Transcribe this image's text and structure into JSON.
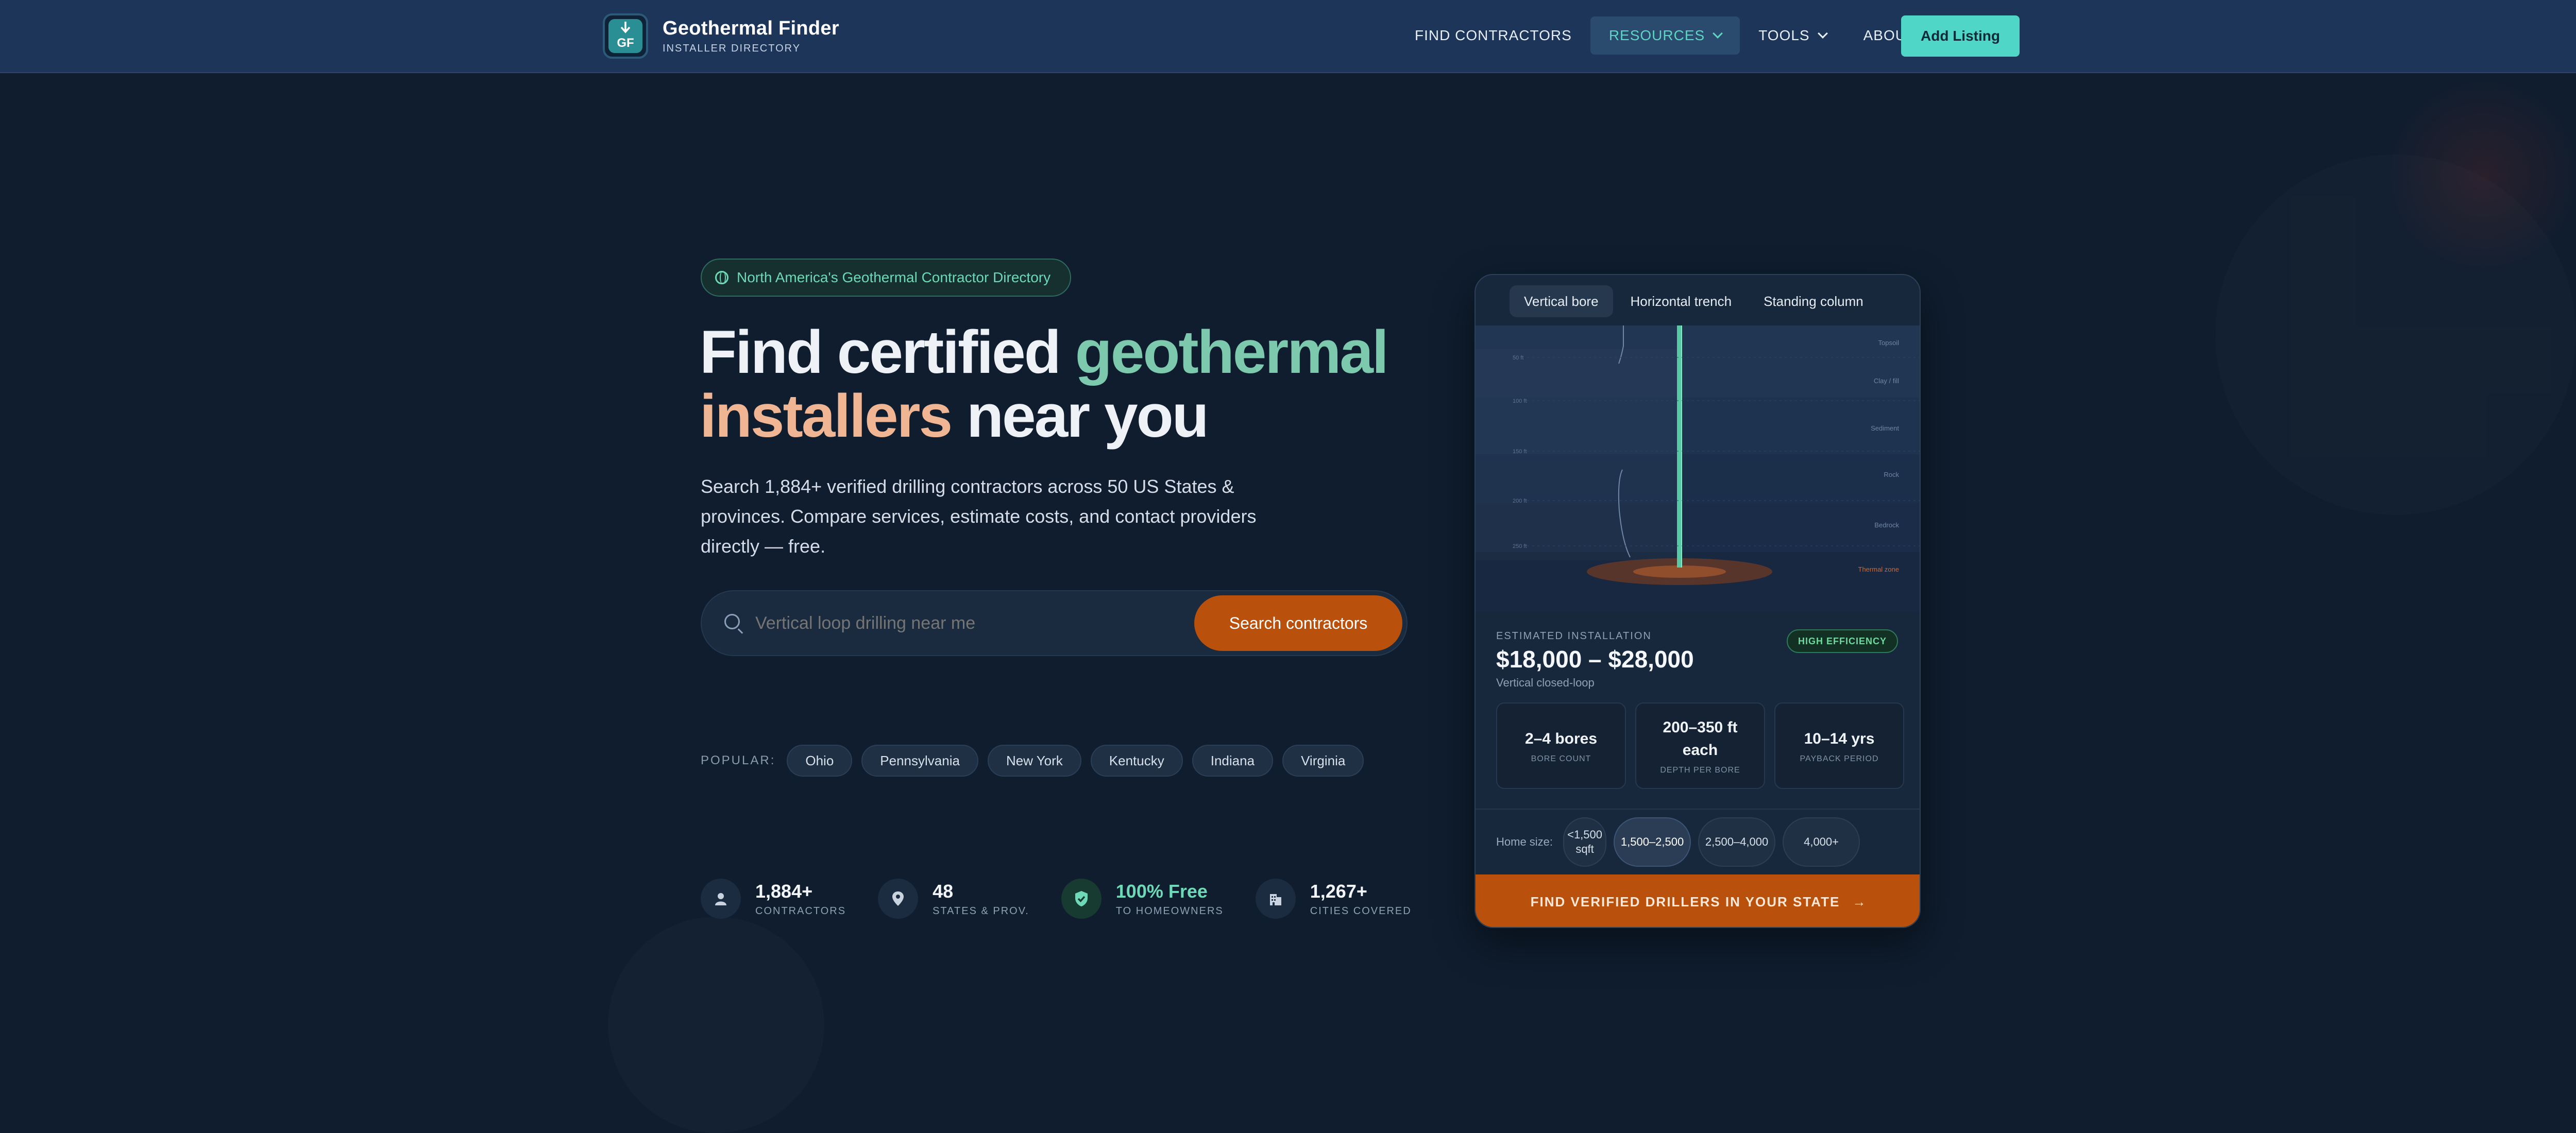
{
  "brand": {
    "name": "Geothermal Finder",
    "subtitle": "INSTALLER DIRECTORY",
    "logo_text": "GF"
  },
  "nav": {
    "items": [
      {
        "label": "FIND CONTRACTORS",
        "active": false,
        "dropdown": false
      },
      {
        "label": "RESOURCES",
        "active": true,
        "dropdown": true
      },
      {
        "label": "TOOLS",
        "active": false,
        "dropdown": true
      },
      {
        "label": "ABOUT",
        "active": false,
        "dropdown": false
      }
    ],
    "cta": "Add Listing"
  },
  "hero": {
    "badge": "North America's Geothermal Contractor Directory",
    "title_part1": "Find certified ",
    "title_highlight1": "geothermal",
    "title_highlight2": "installers",
    "title_part2": " near you",
    "lead": "Search 1,884+ verified drilling contractors across 50 US States & provinces. Compare services, estimate costs, and contact providers directly — free.",
    "search_placeholder": "Vertical loop drilling near me",
    "search_button": "Search contractors",
    "popular_label": "POPULAR:",
    "popular": [
      "Ohio",
      "Pennsylvania",
      "New York",
      "Kentucky",
      "Indiana",
      "Virginia"
    ]
  },
  "stats": [
    {
      "value": "1,884+",
      "label": "CONTRACTORS",
      "icon": "person-icon"
    },
    {
      "value": "48",
      "label": "STATES & PROV.",
      "icon": "location-pin-icon"
    },
    {
      "value": "100% Free",
      "label": "TO HOMEOWNERS",
      "icon": "shield-check-icon"
    },
    {
      "value": "1,267+",
      "label": "CITIES COVERED",
      "icon": "building-icon"
    }
  ],
  "card": {
    "tabs": [
      "Vertical bore",
      "Horizontal trench",
      "Standing column"
    ],
    "active_tab": 0,
    "diagram_layers": [
      "Topsoil",
      "Clay / fill",
      "Sediment",
      "Rock",
      "Bedrock",
      "Thermal zone"
    ],
    "depth_labels": [
      "50 ft",
      "100 ft",
      "150 ft",
      "200 ft",
      "250 ft"
    ],
    "estimate_label": "ESTIMATED INSTALLATION",
    "estimate_value": "$18,000 – $28,000",
    "estimate_sub": "Vertical closed-loop",
    "efficiency_badge": "HIGH EFFICIENCY",
    "metrics": [
      {
        "value": "2–4 bores",
        "label": "BORE COUNT"
      },
      {
        "value": "200–350 ft each",
        "label": "DEPTH PER BORE"
      },
      {
        "value": "10–14 yrs",
        "label": "PAYBACK PERIOD"
      }
    ],
    "home_size_label": "Home size:",
    "home_sizes": [
      "<1,500 sqft",
      "1,500–2,500",
      "2,500–4,000",
      "4,000+"
    ],
    "home_size_active": 1,
    "cta": "FIND VERIFIED DRILLERS IN YOUR STATE",
    "cta_arrow": "→"
  },
  "colors": {
    "bg": "#0f1d2e",
    "nav": "#1d3559",
    "accent_teal": "#4fd6c6",
    "accent_orange": "#b9500c",
    "green": "#7cc9ad",
    "peach": "#f0b694"
  }
}
